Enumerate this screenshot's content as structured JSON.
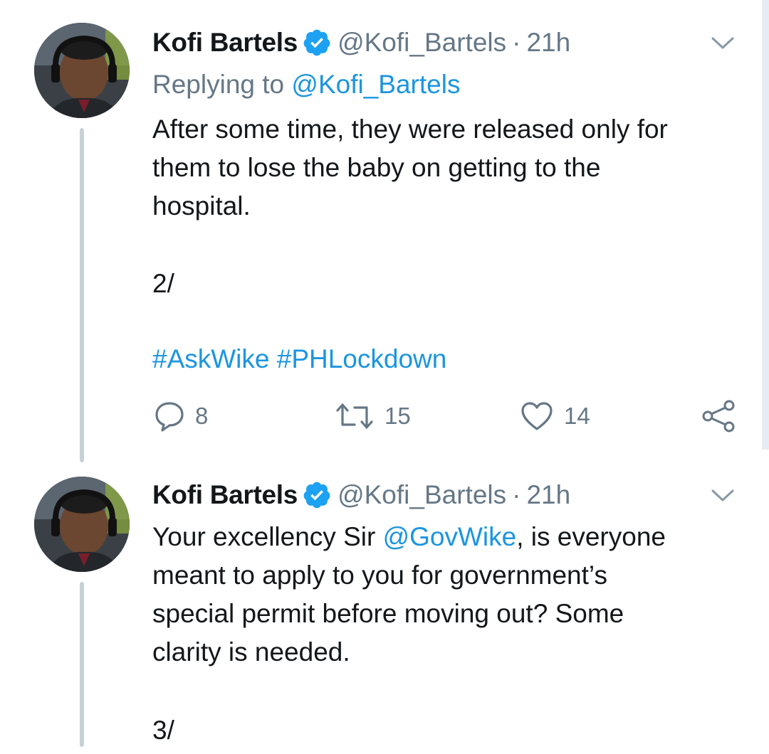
{
  "tweets": [
    {
      "author": {
        "name": "Kofi Bartels",
        "handle": "@Kofi_Bartels"
      },
      "separator": "·",
      "time": "21h",
      "replying": {
        "prefix": "Replying to ",
        "handle": "@Kofi_Bartels"
      },
      "body_lines": [
        "After some time, they were released only for",
        "them to lose the baby on getting to the",
        "hospital."
      ],
      "thread_number": "2/",
      "hashtags": "#AskWike #PHLockdown",
      "actions": {
        "replies": "8",
        "retweets": "15",
        "likes": "14"
      }
    },
    {
      "author": {
        "name": "Kofi Bartels",
        "handle": "@Kofi_Bartels"
      },
      "separator": "·",
      "time": "21h",
      "body": {
        "line1_prefix": "Your excellency Sir ",
        "mention": "@GovWike",
        "line1_suffix": ", is everyone",
        "line2": "meant to apply to you for government’s",
        "line3": "special permit before moving out? Some",
        "line4": "clarity is needed."
      },
      "thread_number": "3/"
    }
  ],
  "icons": {
    "verified": "verified-badge-icon",
    "menu": "chevron-down-icon",
    "reply": "reply-icon",
    "retweet": "retweet-icon",
    "like": "heart-icon",
    "share": "share-icon"
  },
  "colors": {
    "link": "#1b95e0",
    "secondary_text": "#657786",
    "thread_line": "#c7d1d8",
    "verified": "#1da1f2"
  }
}
